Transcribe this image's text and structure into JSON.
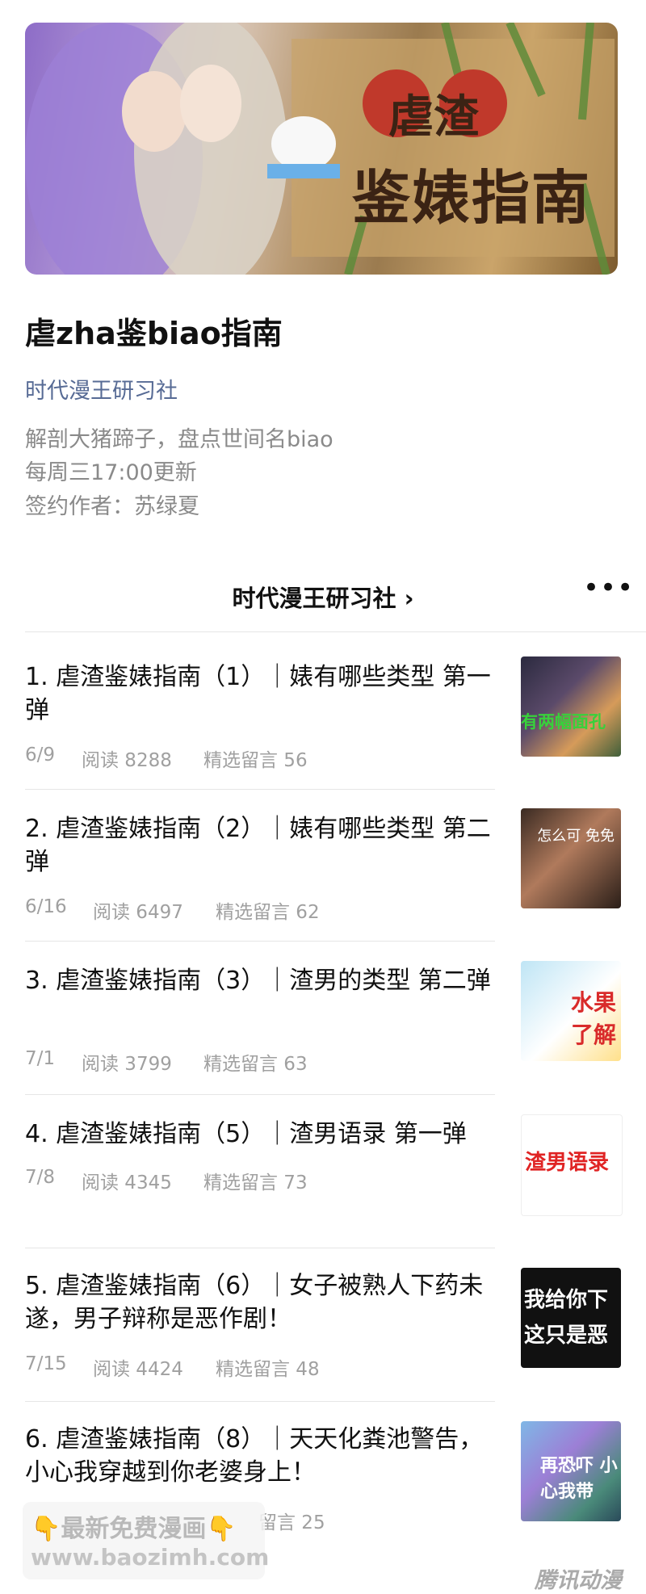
{
  "banner": {
    "line1": "虐渣",
    "line2": "鉴婊指南"
  },
  "title": "虐zha鉴biao指南",
  "account": "时代漫王研习社",
  "description": [
    "解剖大猪蹄子，盘点世间名biao",
    "每周三17:00更新",
    "签约作者：苏绿夏"
  ],
  "nav": {
    "account_label": "时代漫王研习社 ›",
    "more": "•••"
  },
  "articles": [
    {
      "title": "1. 虐渣鉴婊指南（1）｜婊有哪些类型 第一弹",
      "date": "6/9",
      "reads": "阅读 8288",
      "comments": "精选留言 56",
      "thumb_text": "有两幅面孔"
    },
    {
      "title": "2. 虐渣鉴婊指南（2）｜婊有哪些类型 第二弹",
      "date": "6/16",
      "reads": "阅读 6497",
      "comments": "精选留言 62",
      "thumb_text": "怎么可 免免"
    },
    {
      "title": "3. 虐渣鉴婊指南（3）｜渣男的类型 第二弹",
      "date": "7/1",
      "reads": "阅读 3799",
      "comments": "精选留言 63",
      "thumb_text": "水果 了解"
    },
    {
      "title": "4. 虐渣鉴婊指南（5）｜渣男语录 第一弹",
      "date": "7/8",
      "reads": "阅读 4345",
      "comments": "精选留言 73",
      "thumb_text": "渣男语录"
    },
    {
      "title": "5. 虐渣鉴婊指南（6）｜女子被熟人下药未遂，男子辩称是恶作剧！",
      "date": "7/15",
      "reads": "阅读 4424",
      "comments": "精选留言 48",
      "thumb_text": "我给你下 这只是恶"
    },
    {
      "title": "6. 虐渣鉴婊指南（8）｜天天化粪池警告，小心我穿越到你老婆身上！",
      "date": "",
      "reads": "",
      "comments": "留言 25",
      "thumb_text": "再恐吓 小心我带"
    }
  ],
  "watermark": {
    "line1": "👇最新免费漫画👇",
    "line2": "www.baozimh.com"
  },
  "corner_logo": "腾讯动漫",
  "colors": {
    "link": "#576b95",
    "meta": "#a0a0a0",
    "text": "#111111"
  }
}
